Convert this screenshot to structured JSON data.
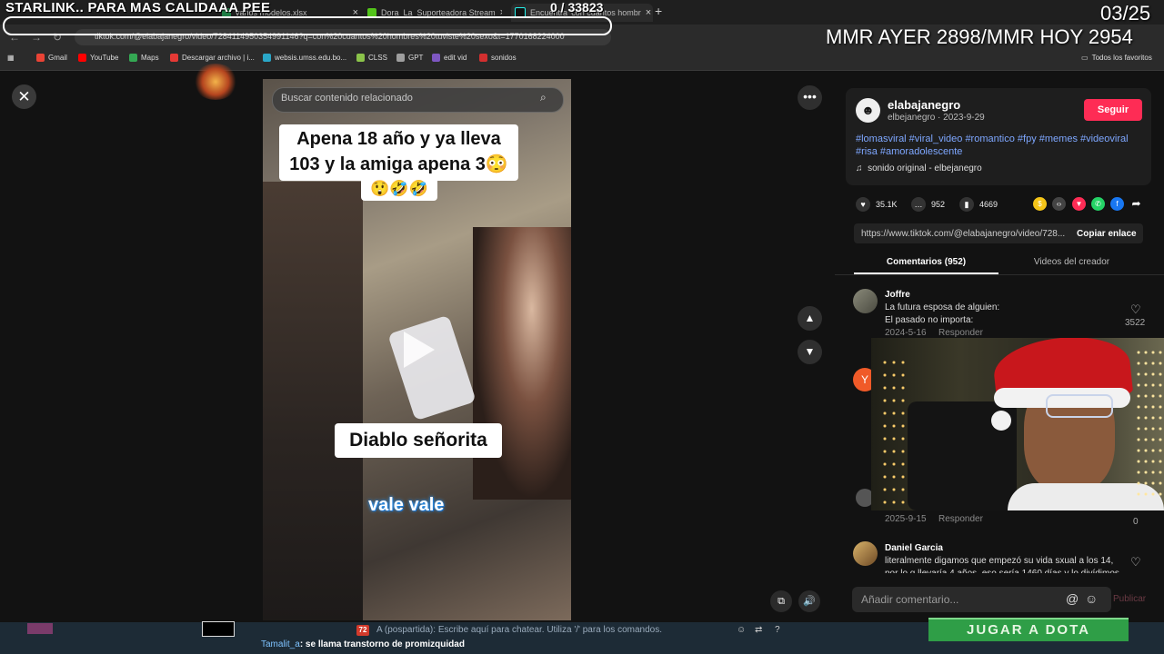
{
  "browser": {
    "tabs": [
      {
        "label": "varios modelos.xlsx",
        "color": "#1e7e45"
      },
      {
        "label": "Dora_La_Suporteadora Stream",
        "color": "#53c41a"
      },
      {
        "label": "Encuentra 'con cuantos hombr",
        "color": "#111111"
      }
    ],
    "new_tab": "+",
    "close": "×",
    "url": "tiktok.com/@elabajanegro/video/7284114950354991146?q=con%20cuantos%20hombres%20tuviste%20sexo&t=1770168224000",
    "bookmarks": [
      {
        "label": "Gmail",
        "color": "#ea4335"
      },
      {
        "label": "YouTube",
        "color": "#ff0000"
      },
      {
        "label": "Maps",
        "color": "#34a853"
      },
      {
        "label": "Descargar archivo | i...",
        "color": "#e53935"
      },
      {
        "label": "websis.umss.edu.bo...",
        "color": "#2aa7c8"
      },
      {
        "label": "CLSS",
        "color": "#8bc34a"
      },
      {
        "label": "GPT",
        "color": "#9e9e9e"
      },
      {
        "label": "edit vid",
        "color": "#7e57c2"
      },
      {
        "label": "sonidos",
        "color": "#d32f2f"
      }
    ],
    "all_bookmarks": "Todos los favoritos"
  },
  "overlay": {
    "title": "STARLINK.. PARA MAS CALIDAAA PEE",
    "counter": "0  / 33823",
    "fraction": "03/25",
    "mmr": "MMR AYER 2898/MMR HOY 2954"
  },
  "video": {
    "search_placeholder": "Buscar contenido relacionado",
    "caption1": "Apena 18 año  y ya lleva 103 y la amiga apena 3😳",
    "caption2": "😲🤣🤣",
    "caption3": "Diablo señorita",
    "caption4": "vale vale"
  },
  "author": {
    "username": "elabajanegro",
    "subline": "elbejanegro · 2023-9-29",
    "follow_label": "Seguir",
    "hashtags": "#lomasviral #viral_video #romantico #fpy #memes #videoviral #risa #amoradolescente",
    "sound": "sonido original - elbejanegro"
  },
  "stats": {
    "likes": "35.1K",
    "comments": "952",
    "saves": "4669"
  },
  "link": {
    "url": "https://www.tiktok.com/@elabajanegro/video/728...",
    "copy_label": "Copiar enlace"
  },
  "tabs": {
    "comments": "Comentarios (952)",
    "videos": "Videos del creador"
  },
  "comments": [
    {
      "name": "Joffre",
      "text": "La futura esposa de alguien:\nEl pasado no importa:",
      "date": "2024-5-16",
      "reply": "Responder",
      "likes": "3522"
    },
    {
      "name": "",
      "text": "",
      "date": "2025-9-15",
      "reply": "Responder",
      "likes": "0"
    },
    {
      "name": "Daniel Garcia",
      "text": "literalmente digamos que empezó su vida sxual a los 14, por lo q llevaría 4 años, eso sería 1460 días y lo divídimos en los",
      "date": "",
      "reply": "",
      "likes": ""
    }
  ],
  "add_comment": {
    "placeholder": "Añadir comentario...",
    "at": "@",
    "emoji": "☺",
    "publish": "Publicar"
  },
  "bottom": {
    "badge": "72",
    "chat_prompt": "A (pospartida): Escribe aquí para chatear. Utiliza '/' para los comandos.",
    "chat_user": "Tamalit_a",
    "chat_msg": ": se llama transtorno de promizquidad",
    "play_button": "JUGAR A DOTA"
  }
}
